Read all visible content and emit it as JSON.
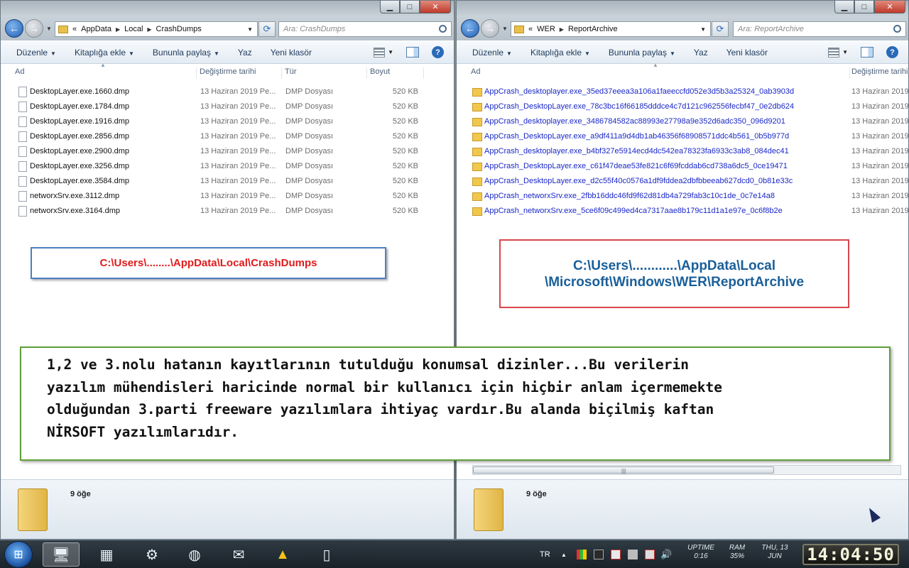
{
  "left": {
    "address": {
      "prefix": "«",
      "crumbs": [
        "AppData",
        "Local",
        "CrashDumps"
      ]
    },
    "search_placeholder": "Ara: CrashDumps",
    "toolbar": [
      "Düzenle",
      "Kitaplığa ekle",
      "Bununla paylaş",
      "Yaz",
      "Yeni klasör"
    ],
    "columns": [
      "Ad",
      "Değiştirme tarihi",
      "Tür",
      "Boyut"
    ],
    "files": [
      {
        "name": "DesktopLayer.exe.1660.dmp",
        "date": "13 Haziran 2019 Pe...",
        "type": "DMP Dosyası",
        "size": "520 KB"
      },
      {
        "name": "DesktopLayer.exe.1784.dmp",
        "date": "13 Haziran 2019 Pe...",
        "type": "DMP Dosyası",
        "size": "520 KB"
      },
      {
        "name": "DesktopLayer.exe.1916.dmp",
        "date": "13 Haziran 2019 Pe...",
        "type": "DMP Dosyası",
        "size": "520 KB"
      },
      {
        "name": "DesktopLayer.exe.2856.dmp",
        "date": "13 Haziran 2019 Pe...",
        "type": "DMP Dosyası",
        "size": "520 KB"
      },
      {
        "name": "DesktopLayer.exe.2900.dmp",
        "date": "13 Haziran 2019 Pe...",
        "type": "DMP Dosyası",
        "size": "520 KB"
      },
      {
        "name": "DesktopLayer.exe.3256.dmp",
        "date": "13 Haziran 2019 Pe...",
        "type": "DMP Dosyası",
        "size": "520 KB"
      },
      {
        "name": "DesktopLayer.exe.3584.dmp",
        "date": "13 Haziran 2019 Pe...",
        "type": "DMP Dosyası",
        "size": "520 KB"
      },
      {
        "name": "networxSrv.exe.3112.dmp",
        "date": "13 Haziran 2019 Pe...",
        "type": "DMP Dosyası",
        "size": "520 KB"
      },
      {
        "name": "networxSrv.exe.3164.dmp",
        "date": "13 Haziran 2019 Pe...",
        "type": "DMP Dosyası",
        "size": "520 KB"
      }
    ],
    "count": "9 öğe",
    "note": "C:\\Users\\........\\AppData\\Local\\CrashDumps"
  },
  "right": {
    "address": {
      "prefix": "«",
      "crumbs": [
        "WER",
        "ReportArchive"
      ]
    },
    "search_placeholder": "Ara: ReportArchive",
    "toolbar": [
      "Düzenle",
      "Kitaplığa ekle",
      "Bununla paylaş",
      "Yaz",
      "Yeni klasör"
    ],
    "columns": [
      "Ad",
      "Değiştirme tarihi"
    ],
    "folders": [
      {
        "name": "AppCrash_desktoplayer.exe_35ed37eeea3a106a1faeeccfd052e3d5b3a25324_0ab3903d",
        "date": "13 Haziran 2019"
      },
      {
        "name": "AppCrash_DesktopLayer.exe_78c3bc16f66185dddce4c7d121c962556fecbf47_0e2db624",
        "date": "13 Haziran 2019"
      },
      {
        "name": "AppCrash_desktoplayer.exe_3486784582ac88993e27798a9e352d6adc350_096d9201",
        "date": "13 Haziran 2019"
      },
      {
        "name": "AppCrash_DesktopLayer.exe_a9df411a9d4db1ab46356f68908571ddc4b561_0b5b977d",
        "date": "13 Haziran 2019"
      },
      {
        "name": "AppCrash_desktoplayer.exe_b4bf327e5914ecd4dc542ea78323fa6933c3ab8_084dec41",
        "date": "13 Haziran 2019"
      },
      {
        "name": "AppCrash_DesktopLayer.exe_c61f47deae53fe821c6f69fcddab6cd738a6dc5_0ce19471",
        "date": "13 Haziran 2019"
      },
      {
        "name": "AppCrash_DesktopLayer.exe_d2c55f40c0576a1df9fddea2dbfbbeeab627dcd0_0b81e33c",
        "date": "13 Haziran 2019"
      },
      {
        "name": "AppCrash_networxSrv.exe_2fbb16ddc46fd9f62d81db4a729fab3c10c1de_0c7e14a8",
        "date": "13 Haziran 2019"
      },
      {
        "name": "AppCrash_networxSrv.exe_5ce6f09c499ed4ca7317aae8b179c11d1a1e97e_0c6f8b2e",
        "date": "13 Haziran 2019"
      }
    ],
    "count": "9 öğe",
    "note_lines": [
      "C:\\Users\\............\\AppData\\Local",
      "\\Microsoft\\Windows\\WER\\ReportArchive"
    ]
  },
  "main_note": [
    "1,2 ve 3.nolu hatanın kayıtlarının tutulduğu konumsal dizinler...Bu verilerin",
    "yazılım mühendisleri haricinde normal bir kullanıcı için hiçbir anlam içermemekte",
    "olduğundan 3.parti freeware yazılımlara ihtiyaç vardır.Bu alanda biçilmiş kaftan",
    "NİRSOFT yazılımlarıdır."
  ],
  "taskbar": {
    "lang": "TR",
    "uptime_label": "UPTIME",
    "uptime_value": "0:16",
    "ram_label": "RAM",
    "ram_value": "35%",
    "date_line1": "THU, 13",
    "date_line2": "JUN",
    "clock": "14:04:50"
  },
  "colors": {
    "link_blue": "#1a28c8",
    "note_red": "#e01b1b",
    "note_blue": "#1a5f99",
    "border_green": "#5f9e3b"
  }
}
